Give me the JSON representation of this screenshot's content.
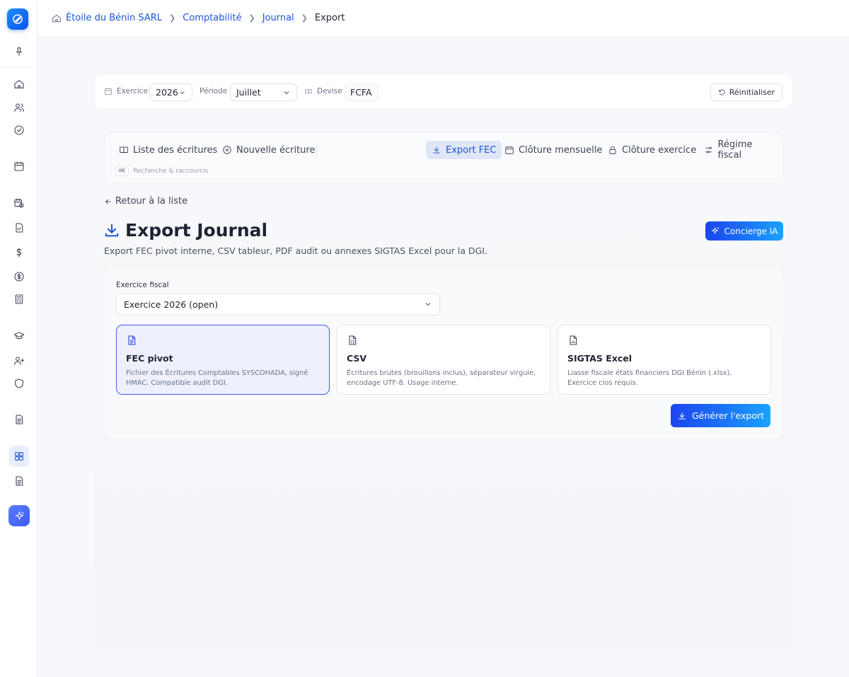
{
  "breadcrumb": {
    "items": [
      "Étoile du Bénin SARL",
      "Comptabilité",
      "Journal"
    ],
    "current": "Export"
  },
  "filters": {
    "exercice_label": "Exercice",
    "exercice_value": "2026",
    "periode_label": "Période",
    "periode_value": "Juillet",
    "devise_label": "Devise",
    "devise_value": "FCFA",
    "reset_label": "Réinitialiser"
  },
  "subnav": {
    "items": [
      {
        "label": "Liste des écritures",
        "icon": "book-icon"
      },
      {
        "label": "Nouvelle écriture",
        "icon": "plus-circle-icon"
      },
      {
        "label": "Export FEC",
        "icon": "download-icon",
        "active": true
      },
      {
        "label": "Clôture mensuelle",
        "icon": "calendar-icon"
      },
      {
        "label": "Clôture exercice",
        "icon": "lock-icon"
      },
      {
        "label": "Régime fiscal",
        "icon": "sliders-icon"
      }
    ],
    "shortcut_key": "⌘K",
    "shortcut_label": "Recherche & raccourcis"
  },
  "page": {
    "back_label": "Retour à la liste",
    "title": "Export Journal",
    "subtitle": "Export FEC pivot interne, CSV tableur, PDF audit ou annexes SIGTAS Excel pour la DGI.",
    "concierge_label": "Concierge IA"
  },
  "form": {
    "exercice_label": "Exercice fiscal",
    "exercice_value": "Exercice 2026 (open)",
    "options": [
      {
        "title": "FEC pivot",
        "desc": "Fichier des Écritures Comptables SYSCOHADA, signé HMAC. Compatible audit DGI.",
        "icon": "document-icon",
        "selected": true
      },
      {
        "title": "CSV",
        "desc": "Écritures brutes (brouillons inclus), séparateur virgule, encodage UTF-8. Usage interne.",
        "icon": "csv-file-icon",
        "selected": false
      },
      {
        "title": "SIGTAS Excel",
        "desc": "Liasse fiscale états financiers DGI Bénin (.xlsx). Exercice clos requis.",
        "icon": "excel-file-icon",
        "selected": false
      }
    ],
    "generate_label": "Générer l'export"
  },
  "colors": {
    "accent": "#1a55d6",
    "button_gradient_start": "#1b45ee",
    "button_gradient_end": "#1aa3ff",
    "selected_border": "#3b5cf0"
  }
}
